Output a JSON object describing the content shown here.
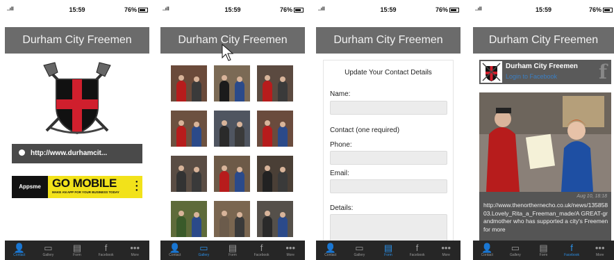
{
  "status": {
    "signal": "..ıll",
    "time": "15:59",
    "battery": "76%"
  },
  "app_title": "Durham City Freemen",
  "tabs": [
    {
      "label": "Contact",
      "icon": "person-icon"
    },
    {
      "label": "Gallery",
      "icon": "gallery-icon"
    },
    {
      "label": "Form",
      "icon": "form-icon"
    },
    {
      "label": "Facebook",
      "icon": "facebook-icon"
    },
    {
      "label": "More",
      "icon": "more-icon"
    }
  ],
  "screen1": {
    "link_text": "http://www.durhamcit...",
    "banner": {
      "logo": "Appsme",
      "headline": "GO MOBILE",
      "tagline": "MAKE AN APP FOR YOUR BUSINESS TODAY"
    }
  },
  "screen3": {
    "form_title": "Update Your Contact Details",
    "name_label": "Name:",
    "contact_label": "Contact (one required)",
    "phone_label": "Phone:",
    "email_label": "Email:",
    "details_label": "Details:"
  },
  "screen4": {
    "page_name": "Durham City Freemen",
    "login_text": "Login to Facebook",
    "post_date": "Aug 10, 18:18",
    "post_text": "http://www.thenorthernecho.co.uk/news/13585803.Lovely_Rita_a_Freeman_made/A GREAT-grandmother who has supported a city's Freemen for more"
  },
  "colors": {
    "titlebar": "#6b6b6b",
    "tabbar": "#262626",
    "active_tab": "#2b8fe6",
    "banner": "#f2e21a"
  }
}
